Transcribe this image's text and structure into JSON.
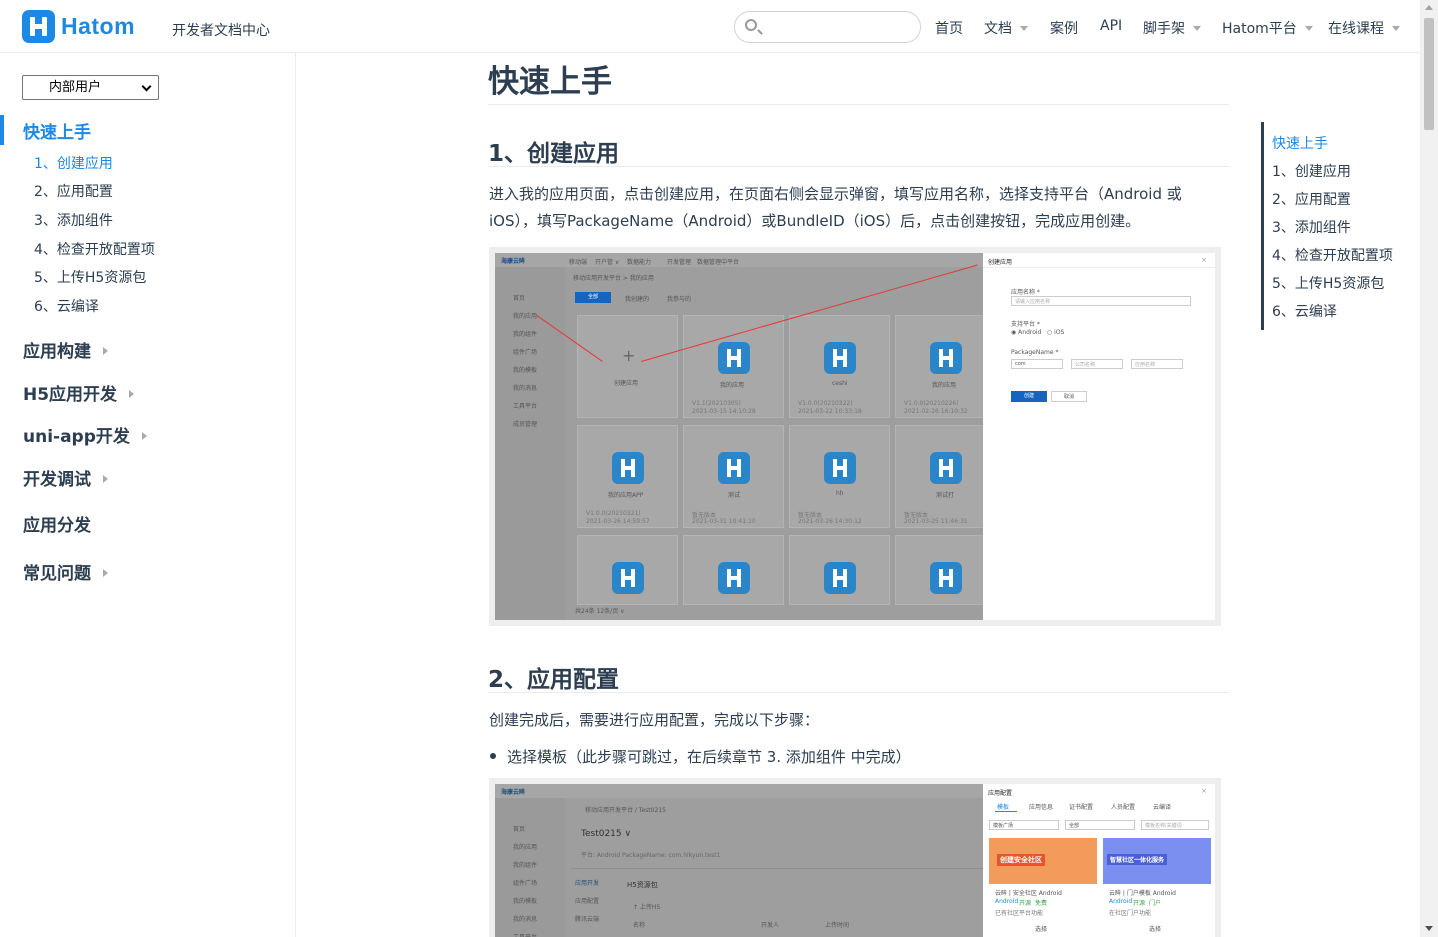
{
  "header": {
    "brand": "Hatom",
    "subtitle": "开发者文档中心",
    "search_placeholder": "",
    "nav": [
      {
        "label": "首页",
        "dropdown": false
      },
      {
        "label": "文档",
        "dropdown": true
      },
      {
        "label": "案例",
        "dropdown": false
      },
      {
        "label": "API",
        "dropdown": false
      },
      {
        "label": "脚手架",
        "dropdown": true
      },
      {
        "label": "Hatom平台",
        "dropdown": true
      },
      {
        "label": "在线课程",
        "dropdown": true
      }
    ]
  },
  "sidebar": {
    "user_select": "内部用户",
    "groups": [
      {
        "label": "快速上手",
        "active": true,
        "expandable": false
      },
      {
        "label": "应用构建",
        "expandable": true
      },
      {
        "label": "H5应用开发",
        "expandable": true
      },
      {
        "label": "uni-app开发",
        "expandable": true
      },
      {
        "label": "开发调试",
        "expandable": true
      },
      {
        "label": "应用分发",
        "expandable": false
      },
      {
        "label": "常见问题",
        "expandable": true
      }
    ],
    "sub_items": [
      "1、创建应用",
      "2、应用配置",
      "3、添加组件",
      "4、检查开放配置项",
      "5、上传H5资源包",
      "6、云编译"
    ]
  },
  "main": {
    "title": "快速上手",
    "section1": {
      "heading": "1、创建应用",
      "text": "进入我的应用页面，点击创建应用，在页面右侧会显示弹窗，填写应用名称，选择支持平台（Android 或 iOS），填写PackageName（Android）或BundleID（iOS）后，点击创建按钮，完成应用创建。"
    },
    "shot1": {
      "brand": "海康云眸",
      "top_tabs": [
        "移动端",
        "开户管 ∨",
        "数据能力",
        "开发管理",
        "数据管理中平台"
      ],
      "breadcrumb": "移动应用开发平台 > 我的应用",
      "filters": [
        "全部",
        "我创建的",
        "我参与的"
      ],
      "side_menu": [
        "首页",
        "我的应用",
        "我的组件",
        "组件广场",
        "我的模板",
        "我的消息",
        "工具平台",
        "成员管理"
      ],
      "add_label": "创建应用",
      "apps": [
        {
          "name": "我的应用",
          "ver": "V1.1(20210305)",
          "time": "2021-03-15 14:10:28"
        },
        {
          "name": "ceshi",
          "ver": "V1.0.0(20210322)",
          "time": "2021-03-22 10:33:18"
        },
        {
          "name": "我的应用",
          "ver": "V1.0.0(20210226)",
          "time": "2021-02-26 16:10:32"
        },
        {
          "name": "我的应用APP",
          "ver": "V1.0.0(20210321)",
          "time": "2021-03-26 14:59:57"
        },
        {
          "name": "测试",
          "ver": "暂无版本",
          "time": "2021-03-31 10:41:10"
        },
        {
          "name": "hh",
          "ver": "暂无版本",
          "time": "2021-03-26 14:30:12"
        },
        {
          "name": "测试打",
          "ver": "暂无版本",
          "time": "2021-03-25 11:46:31"
        }
      ],
      "pagination": "共24条  12条/页 ∨",
      "dialog": {
        "title": "创建应用",
        "name_label": "应用名称 *",
        "name_placeholder": "请输入应用名称",
        "platform_label": "支持平台 *",
        "platforms": [
          "Android",
          "iOS"
        ],
        "package_label": "PackageName *",
        "package_parts": [
          "com",
          "公司名称",
          "应用名称"
        ],
        "confirm": "创建",
        "cancel": "取消"
      }
    },
    "section2": {
      "heading": "2、应用配置",
      "text": "创建完成后，需要进行应用配置，完成以下步骤：",
      "bullet": "选择模板（此步骤可跳过，在后续章节 3. 添加组件 中完成）"
    },
    "shot2": {
      "brand": "海康云眸",
      "breadcrumb": "移动应用开发平台 / Test0215",
      "app_name": "Test0215 ∨",
      "platform": "平台:  Android    PackageName:  com.hikyun.test1",
      "left_tabs": [
        "应用开发",
        "应用配置",
        "腾讯云端"
      ],
      "h5_label": "H5资源包",
      "upload": "↑ 上传H5",
      "cols": [
        "名称",
        "开发人",
        "上传时间"
      ],
      "dialog": {
        "title": "应用配置",
        "tabs": [
          "模板",
          "应用信息",
          "证书配置",
          "人员配置",
          "云编译"
        ],
        "selects": [
          "模板广场",
          "全部"
        ],
        "search_placeholder": "模板名称/关键词",
        "templates": [
          {
            "banner": "创建安全社区",
            "name": "云眸 | 安全社区 Android",
            "tags": [
              "Android",
              "开源",
              "免费"
            ],
            "desc": "已有社区平台功能"
          },
          {
            "banner": "智慧社区一体化服务",
            "name": "云眸 | 门户模板 Android",
            "tags": [
              "Android",
              "开源",
              "门户"
            ],
            "desc": "在社区门户功能"
          }
        ],
        "use_label": "选择"
      }
    }
  },
  "toc": [
    "快速上手",
    "1、创建应用",
    "2、应用配置",
    "3、添加组件",
    "4、检查开放配置项",
    "5、上传H5资源包",
    "6、云编译"
  ],
  "colors": {
    "accent": "#1e88e5",
    "text": "#2c3e50",
    "border": "#eaecef"
  }
}
